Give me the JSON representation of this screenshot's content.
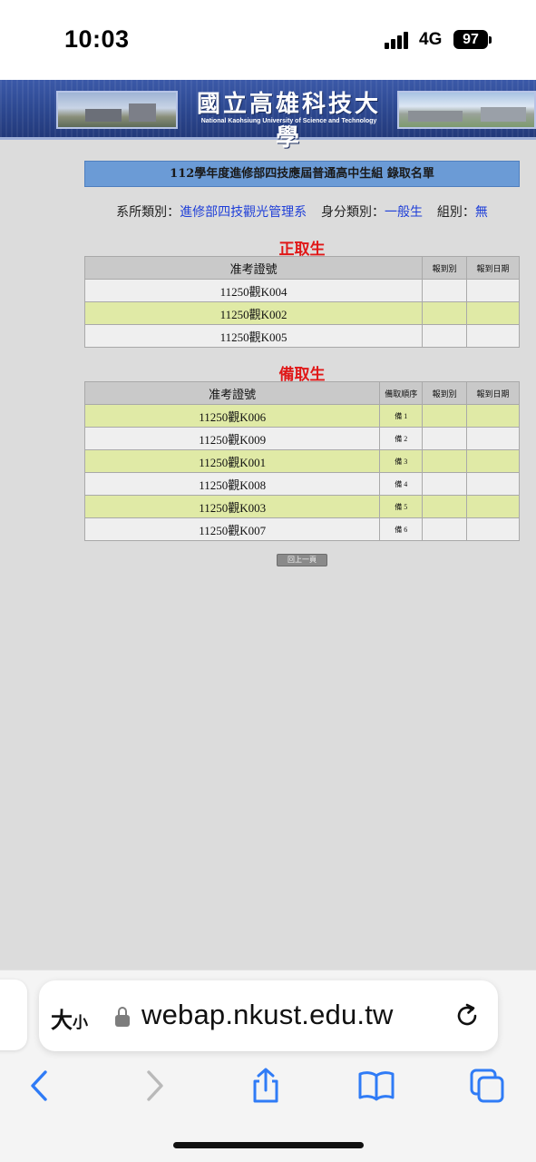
{
  "status_bar": {
    "time": "10:03",
    "network": "4G",
    "battery": "97"
  },
  "banner": {
    "name_zh": "國立高雄科技大學",
    "name_en": "National Kaohsiung University of Science and Technology"
  },
  "title": "112學年度進修部四技應屆普通高中生組 錄取名單",
  "filters": {
    "dept_label": "系所類別：",
    "dept_value": "進修部四技觀光管理系",
    "identity_label": "身分類別：",
    "identity_value": "一般生",
    "group_label": "組別：",
    "group_value": "無"
  },
  "admitted": {
    "title": "正取生",
    "headers": [
      "准考證號",
      "報到別",
      "報到日期"
    ],
    "rows": [
      {
        "id": "11250觀K004"
      },
      {
        "id": "11250觀K002"
      },
      {
        "id": "11250觀K005"
      }
    ]
  },
  "waitlist": {
    "title": "備取生",
    "headers": [
      "准考證號",
      "備取順序",
      "報到別",
      "報到日期"
    ],
    "rows": [
      {
        "id": "11250觀K006",
        "order": "備 1"
      },
      {
        "id": "11250觀K009",
        "order": "備 2"
      },
      {
        "id": "11250觀K001",
        "order": "備 3"
      },
      {
        "id": "11250觀K008",
        "order": "備 4"
      },
      {
        "id": "11250觀K003",
        "order": "備 5"
      },
      {
        "id": "11250觀K007",
        "order": "備 6"
      }
    ]
  },
  "back_button": "回上一頁",
  "browser": {
    "text_size": "大",
    "text_size_small": "小",
    "url": "webap.nkust.edu.tw"
  },
  "colors": {
    "banner": "#2c478f",
    "title_bar": "#6b9bd6",
    "section_title": "#e01818",
    "highlight_row": "#e0eaa6",
    "link_blue": "#1f3fd8",
    "ios_blue": "#2f7bf6"
  },
  "icons": [
    "signal-icon",
    "battery-icon",
    "lock-icon",
    "reload-icon",
    "back-arrow-icon",
    "forward-arrow-icon",
    "share-icon",
    "bookmarks-icon",
    "tabs-icon"
  ]
}
